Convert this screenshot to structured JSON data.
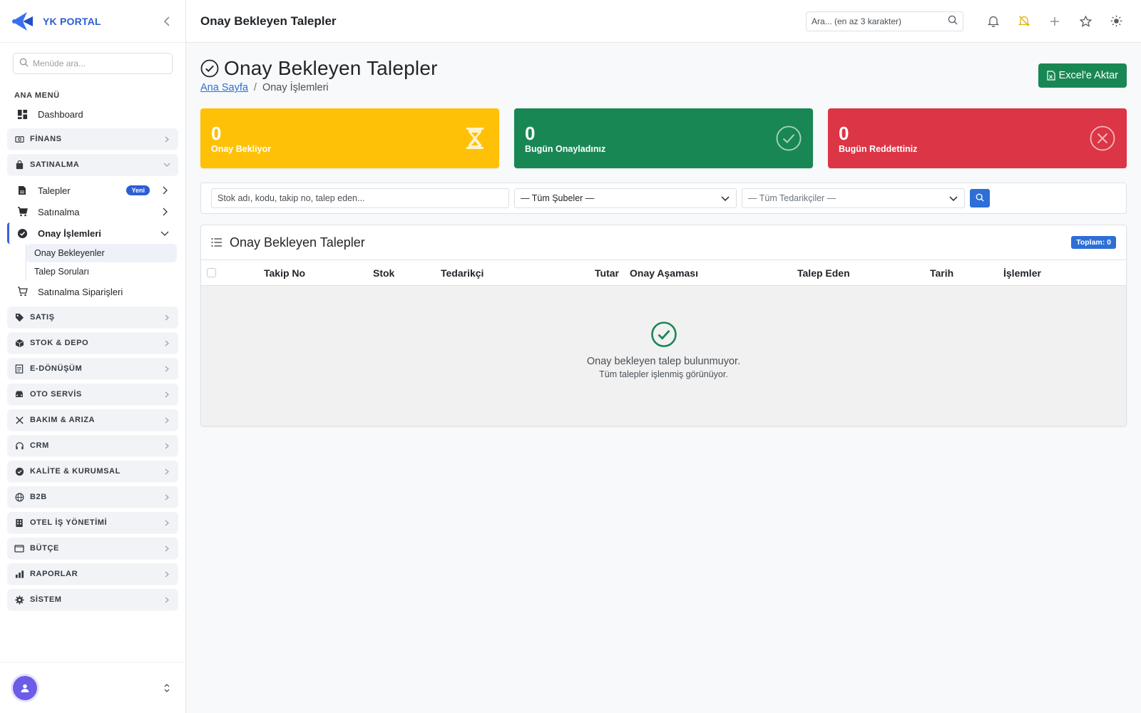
{
  "brand": {
    "name": "YK PORTAL"
  },
  "sidebar": {
    "search_placeholder": "Menüde ara...",
    "heading": "ANA MENÜ",
    "dashboard": "Dashboard",
    "groups": {
      "finans": "FİNANS",
      "satinalma": "SATINALMA",
      "satis": "SATIŞ",
      "stok": "STOK & DEPO",
      "edonusum": "E-DÖNÜŞÜM",
      "oto": "OTO SERVİS",
      "bakim": "BAKIM & ARIZA",
      "crm": "CRM",
      "kalite": "KALİTE & KURUMSAL",
      "b2b": "B2B",
      "otel": "OTEL İŞ YÖNETİMİ",
      "butce": "BÜTÇE",
      "raporlar": "RAPORLAR",
      "sistem": "SİSTEM"
    },
    "satinalma_items": {
      "talepler": "Talepler",
      "talepler_badge": "Yeni",
      "satinalma": "Satınalma",
      "onay": "Onay İşlemleri",
      "onay_bekleyenler": "Onay Bekleyenler",
      "talep_sorulari": "Talep Soruları",
      "siparisler": "Satınalma Siparişleri"
    }
  },
  "topbar": {
    "title": "Onay Bekleyen Talepler",
    "search_placeholder": "Ara... (en az 3 karakter)"
  },
  "page": {
    "title": "Onay Bekleyen Talepler",
    "breadcrumb_home": "Ana Sayfa",
    "breadcrumb_sep": "/",
    "breadcrumb_current": "Onay İşlemleri",
    "excel_button": "Excel'e Aktar"
  },
  "stats": {
    "pending": {
      "value": "0",
      "label": "Onay Bekliyor",
      "color": "#ffc107"
    },
    "approved": {
      "value": "0",
      "label": "Bugün Onayladınız",
      "color": "#198754"
    },
    "rejected": {
      "value": "0",
      "label": "Bugün Reddettiniz",
      "color": "#dc3545"
    }
  },
  "filters": {
    "search_placeholder": "Stok adı, kodu, takip no, talep eden...",
    "branch": "— Tüm Şubeler —",
    "supplier": "— Tüm Tedarikçiler —"
  },
  "table": {
    "title": "Onay Bekleyen Talepler",
    "total_badge": "Toplam: 0",
    "columns": [
      "Takip No",
      "Stok",
      "Tedarikçi",
      "Tutar",
      "Onay Aşaması",
      "Talep Eden",
      "Tarih",
      "İşlemler"
    ],
    "empty_title": "Onay bekleyen talep bulunmuyor.",
    "empty_sub": "Tüm talepler işlenmiş görünüyor."
  },
  "colors": {
    "accent": "#2d6fd6",
    "brand": "#2d5cd6",
    "success": "#198754",
    "warning": "#ffc107",
    "danger": "#dc3545"
  }
}
